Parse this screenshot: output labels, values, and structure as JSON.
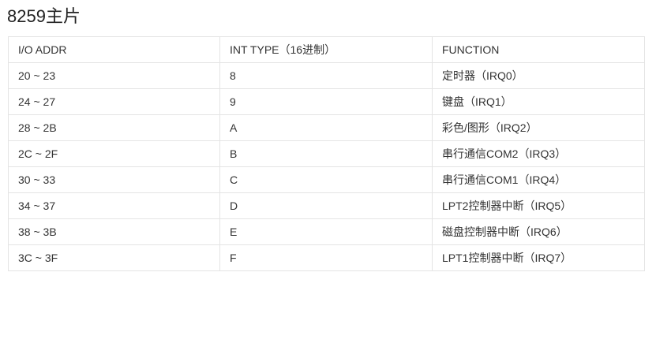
{
  "page": {
    "title": "8259主片"
  },
  "table": {
    "headers": [
      "I/O ADDR",
      "INT TYPE（16进制）",
      "FUNCTION"
    ],
    "rows": [
      [
        "20 ~ 23",
        "8",
        "定时器（IRQ0）"
      ],
      [
        "24 ~ 27",
        "9",
        "键盘（IRQ1）"
      ],
      [
        "28 ~ 2B",
        "A",
        "彩色/图形（IRQ2）"
      ],
      [
        "2C ~ 2F",
        "B",
        "串行通信COM2（IRQ3）"
      ],
      [
        "30 ~ 33",
        "C",
        "串行通信COM1（IRQ4）"
      ],
      [
        "34 ~ 37",
        "D",
        "LPT2控制器中断（IRQ5）"
      ],
      [
        "38 ~ 3B",
        "E",
        "磁盘控制器中断（IRQ6）"
      ],
      [
        "3C ~ 3F",
        "F",
        "LPT1控制器中断（IRQ7）"
      ]
    ]
  }
}
